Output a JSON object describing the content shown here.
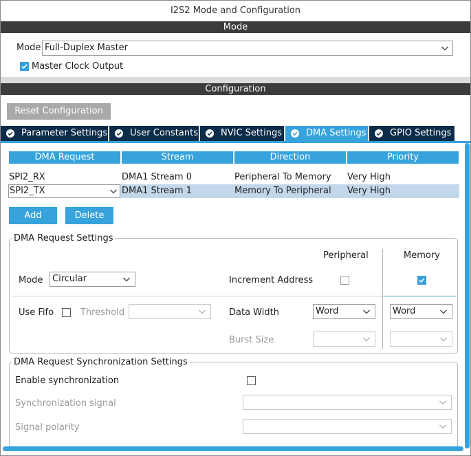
{
  "window": {
    "title": "I2S2 Mode and Configuration"
  },
  "mode_section": {
    "header": "Mode",
    "mode_label": "Mode",
    "mode_value": "Full-Duplex Master",
    "master_clock_label": "Master Clock Output",
    "master_clock_checked": true
  },
  "config_section": {
    "header": "Configuration",
    "reset_button": "Reset Configuration"
  },
  "tabs": [
    {
      "label": "Parameter Settings",
      "active": false
    },
    {
      "label": "User Constants",
      "active": false
    },
    {
      "label": "NVIC Settings",
      "active": false
    },
    {
      "label": "DMA Settings",
      "active": true
    },
    {
      "label": "GPIO Settings",
      "active": false
    }
  ],
  "dma_table": {
    "columns": [
      "DMA Request",
      "Stream",
      "Direction",
      "Priority"
    ],
    "rows": [
      {
        "request": "SPI2_RX",
        "stream": "DMA1 Stream 0",
        "direction": "Peripheral To Memory",
        "priority": "Very High"
      },
      {
        "request": "SPI2_TX",
        "stream": "DMA1 Stream 1",
        "direction": "Memory To Peripheral",
        "priority": "Very High"
      }
    ]
  },
  "table_buttons": {
    "add": "Add",
    "delete": "Delete"
  },
  "dma_request_settings": {
    "title": "DMA Request Settings",
    "peripheral_label": "Peripheral",
    "memory_label": "Memory",
    "mode_label": "Mode",
    "mode_value": "Circular",
    "increment_address_label": "Increment Address",
    "increment_peripheral_checked": false,
    "increment_memory_checked": true,
    "use_fifo_label": "Use Fifo",
    "use_fifo_checked": false,
    "threshold_label": "Threshold",
    "threshold_value": "",
    "data_width_label": "Data Width",
    "peripheral_data_width": "Word",
    "memory_data_width": "Word",
    "burst_size_label": "Burst Size",
    "peripheral_burst_size": "",
    "memory_burst_size": ""
  },
  "sync_settings": {
    "title": "DMA Request Synchronization Settings",
    "enable_label": "Enable synchronization",
    "enable_checked": false,
    "signal_label": "Synchronization signal",
    "signal_value": "",
    "polarity_label": "Signal polarity",
    "polarity_value": ""
  },
  "icons": {
    "tab_check": "check-circle-icon",
    "dropdown": "chevron-down-icon",
    "checkbox_check": "check-icon"
  },
  "colors": {
    "accent": "#36a3dc",
    "tab_dark": "#0c2d4a",
    "section_header": "#3c3c3c",
    "selected_row": "#c3d7ea"
  }
}
